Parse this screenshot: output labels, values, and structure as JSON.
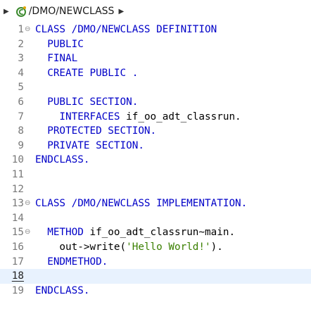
{
  "breadcrumb": {
    "expand_icon": "triangle-right",
    "class_icon": "abap-class-icon",
    "path": "/DMO/NEWCLASS",
    "trail_icon": "triangle-right"
  },
  "colors": {
    "keyword": "#0000c8",
    "string": "#3a7f00",
    "current_line": "#e8f2fe",
    "class_icon_green": "#3c8a2e"
  },
  "editor": {
    "current_line": "18",
    "lines": [
      {
        "n": "1",
        "fold": "⊖",
        "tokens": [
          {
            "t": "CLASS /DMO/NEWCLASS DEFINITION",
            "c": "kw"
          }
        ]
      },
      {
        "n": "2",
        "fold": "",
        "tokens": [
          {
            "t": "  PUBLIC",
            "c": "kw"
          }
        ]
      },
      {
        "n": "3",
        "fold": "",
        "tokens": [
          {
            "t": "  FINAL",
            "c": "kw"
          }
        ]
      },
      {
        "n": "4",
        "fold": "",
        "tokens": [
          {
            "t": "  CREATE PUBLIC .",
            "c": "kw"
          }
        ]
      },
      {
        "n": "5",
        "fold": "",
        "tokens": []
      },
      {
        "n": "6",
        "fold": "",
        "tokens": [
          {
            "t": "  PUBLIC SECTION.",
            "c": "kw"
          }
        ]
      },
      {
        "n": "7",
        "fold": "",
        "tokens": [
          {
            "t": "    INTERFACES ",
            "c": "kw"
          },
          {
            "t": "if_oo_adt_classrun.",
            "c": "plain"
          }
        ]
      },
      {
        "n": "8",
        "fold": "",
        "tokens": [
          {
            "t": "  PROTECTED SECTION.",
            "c": "kw"
          }
        ]
      },
      {
        "n": "9",
        "fold": "",
        "tokens": [
          {
            "t": "  PRIVATE SECTION.",
            "c": "kw"
          }
        ]
      },
      {
        "n": "10",
        "fold": "",
        "tokens": [
          {
            "t": "ENDCLASS.",
            "c": "kw"
          }
        ]
      },
      {
        "n": "11",
        "fold": "",
        "tokens": []
      },
      {
        "n": "12",
        "fold": "",
        "tokens": []
      },
      {
        "n": "13",
        "fold": "⊖",
        "tokens": [
          {
            "t": "CLASS /DMO/NEWCLASS IMPLEMENTATION.",
            "c": "kw"
          }
        ]
      },
      {
        "n": "14",
        "fold": "",
        "tokens": []
      },
      {
        "n": "15",
        "fold": "⊖",
        "tokens": [
          {
            "t": "  METHOD ",
            "c": "kw"
          },
          {
            "t": "if_oo_adt_classrun~main.",
            "c": "plain"
          }
        ]
      },
      {
        "n": "16",
        "fold": "",
        "tokens": [
          {
            "t": "    out->write(",
            "c": "plain"
          },
          {
            "t": "'Hello World!'",
            "c": "str"
          },
          {
            "t": ").",
            "c": "plain"
          }
        ]
      },
      {
        "n": "17",
        "fold": "",
        "tokens": [
          {
            "t": "  ENDMETHOD.",
            "c": "kw"
          }
        ]
      },
      {
        "n": "18",
        "fold": "",
        "tokens": []
      },
      {
        "n": "19",
        "fold": "",
        "tokens": [
          {
            "t": "ENDCLASS.",
            "c": "kw"
          }
        ]
      }
    ]
  }
}
